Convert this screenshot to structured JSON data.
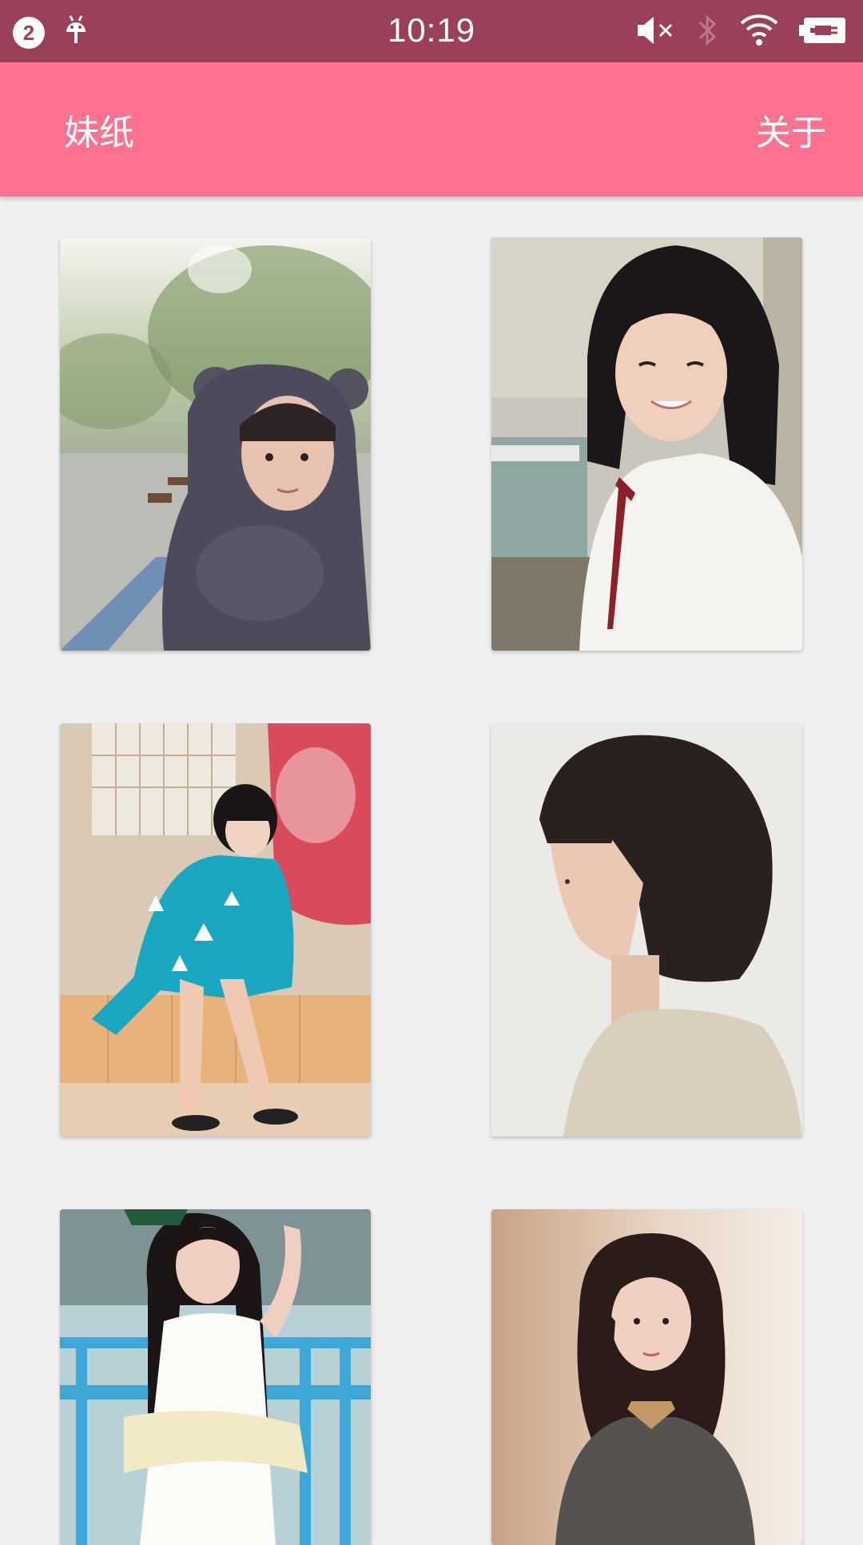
{
  "status_bar": {
    "notification_count": "2",
    "time": "10:19",
    "icons": [
      "notification-count-icon",
      "android-icon",
      "mute-icon",
      "bluetooth-icon",
      "wifi-icon",
      "battery-charging-icon"
    ]
  },
  "app_bar": {
    "title": "妹纸",
    "about_label": "关于"
  },
  "grid": {
    "photos": [
      {
        "subject": "bear-hood-portrait"
      },
      {
        "subject": "school-uniform-portrait"
      },
      {
        "subject": "kimono-sitting-portrait"
      },
      {
        "subject": "bob-haircut-profile"
      },
      {
        "subject": "railing-portrait"
      },
      {
        "subject": "wavy-hair-portrait"
      }
    ]
  },
  "colors": {
    "status_bar": "#9a4159",
    "app_bar": "#fc7290",
    "background": "#efefef"
  }
}
